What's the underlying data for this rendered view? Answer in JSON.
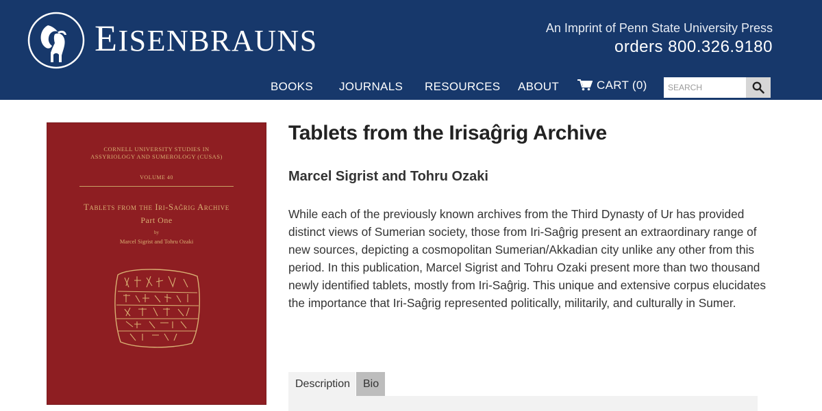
{
  "header": {
    "brand": "Eisenbrauns",
    "brand_first": "E",
    "brand_rest": "ISENBRAUNS",
    "imprint": "An Imprint of Penn State University Press",
    "orders": "orders 800.326.9180",
    "bg_color": "#17386b",
    "logo_icon": "ibex-logo-icon"
  },
  "nav": {
    "items": [
      {
        "label": "BOOKS"
      },
      {
        "label": "JOURNALS"
      },
      {
        "label": "RESOURCES"
      },
      {
        "label": "ABOUT"
      }
    ],
    "cart_label": "CART (0)",
    "cart_icon": "cart-icon",
    "search_placeholder": "SEARCH",
    "search_icon": "magnifier-icon"
  },
  "cover": {
    "series": "Cornell University Studies in Assyriology and Sumerology (CUSAS)",
    "volume": "Volume 40",
    "title": "Tablets from the Iri-Saĝrig Archive",
    "part": "Part One",
    "by": "by",
    "authors": "Marcel Sigrist and Tohru Ozaki",
    "color": "#8e1e22"
  },
  "book": {
    "title": "Tablets from the Irisaĝrig Archive",
    "authors": "Marcel Sigrist and Tohru Ozaki",
    "description": "While each of the previously known archives from the Third Dynasty of Ur has provided distinct views of Sumerian society, those from Iri-Saĝrig present an extraordinary range of new sources, depicting a cosmopolitan Sumerian/Akkadian city unlike any other from this period. In this publication, Marcel Sigrist and Tohru Ozaki present more than two thousand newly identified tablets, mostly from Iri-Saĝrig. This unique and extensive corpus elucidates the importance that Iri-Saĝrig represented politically, militarily, and culturally in Sumer."
  },
  "tabs": [
    {
      "label": "Description"
    },
    {
      "label": "Bio"
    }
  ]
}
